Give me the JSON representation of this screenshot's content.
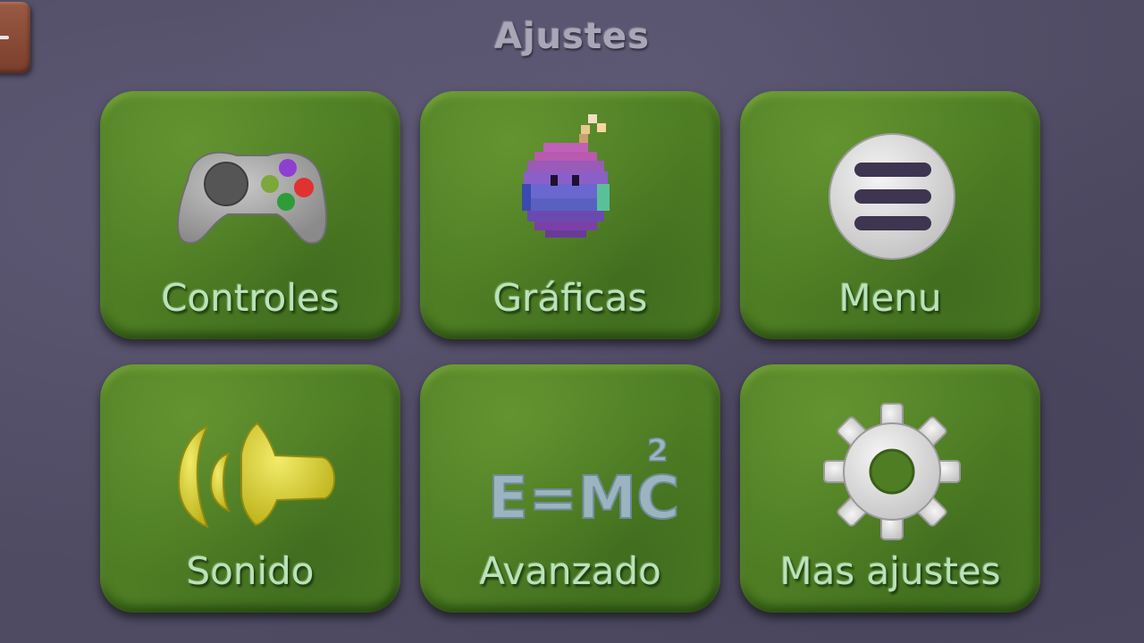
{
  "screen": {
    "title": "Ajustes",
    "back_label": "-"
  },
  "tiles": [
    {
      "label": "Controles",
      "icon": "gamepad-icon"
    },
    {
      "label": "Gráficas",
      "icon": "pixel-bomb-icon"
    },
    {
      "label": "Menu",
      "icon": "menu-icon"
    },
    {
      "label": "Sonido",
      "icon": "speaker-icon"
    },
    {
      "label": "Avanzado",
      "icon": "formula-icon",
      "icon_text": "E=MC",
      "icon_superscript": "2"
    },
    {
      "label": "Mas ajustes",
      "icon": "gear-icon"
    }
  ],
  "colors": {
    "background": "#4f4b63",
    "tile": "#4e7d24",
    "tile_label": "#b9e3b9",
    "title": "#a9a6b7",
    "back_tab": "#8a4a36"
  }
}
